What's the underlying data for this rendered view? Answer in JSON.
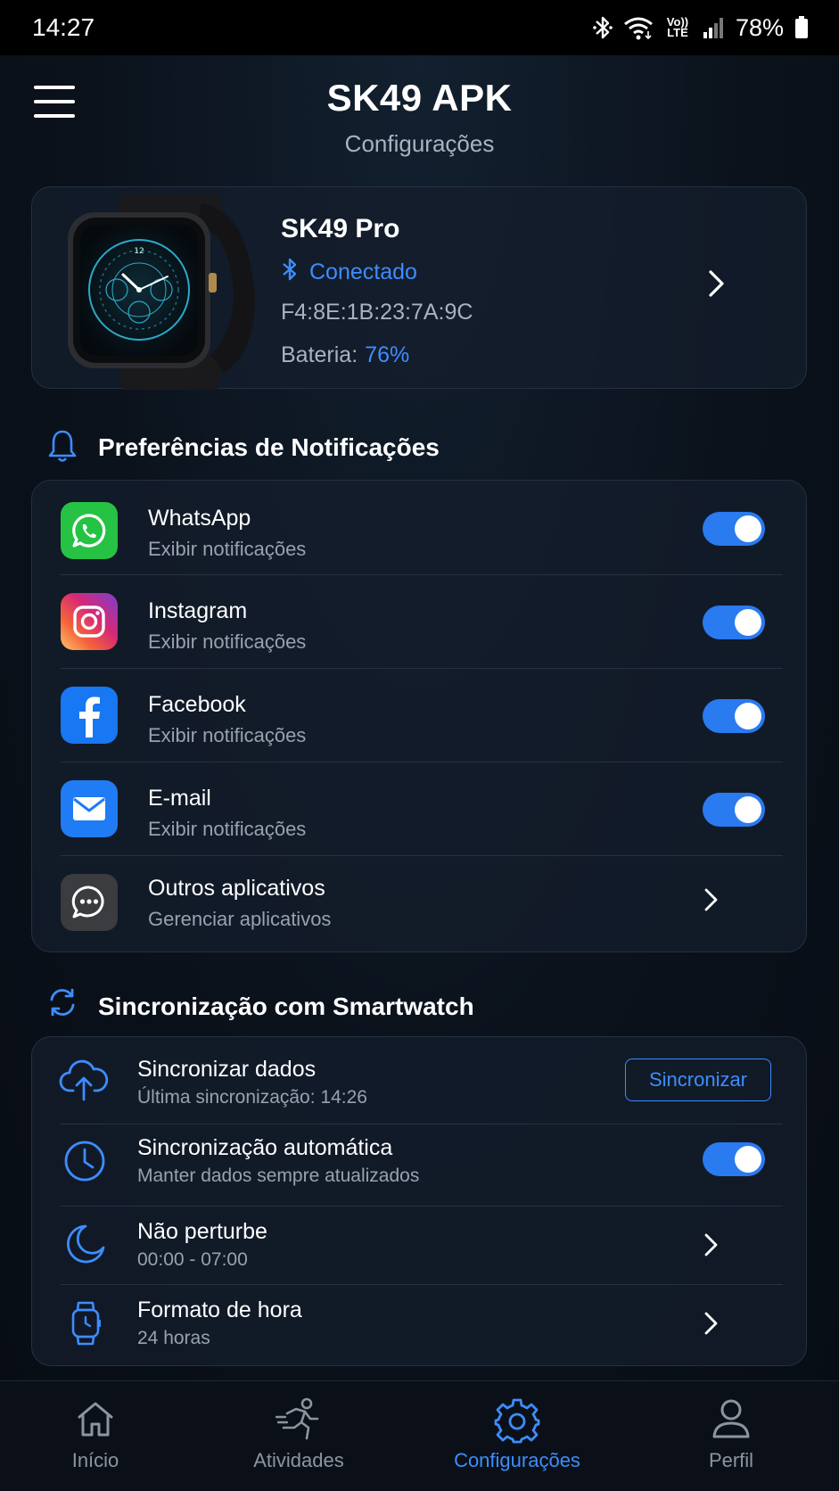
{
  "status_bar": {
    "time": "14:27",
    "volte": "Vo)) LTE",
    "battery": "78%"
  },
  "header": {
    "title": "SK49 APK",
    "subtitle": "Configurações"
  },
  "device": {
    "name": "SK49 Pro",
    "status": "Conectado",
    "mac": "F4:8E:1B:23:7A:9C",
    "battery_label": "Bateria:",
    "battery_value": "76%"
  },
  "notifications": {
    "title": "Preferências de Notificações",
    "items": [
      {
        "name": "WhatsApp",
        "sub": "Exibir notificações",
        "enabled": true
      },
      {
        "name": "Instagram",
        "sub": "Exibir notificações",
        "enabled": true
      },
      {
        "name": "Facebook",
        "sub": "Exibir notificações",
        "enabled": true
      },
      {
        "name": "E-mail",
        "sub": "Exibir notificações",
        "enabled": true
      },
      {
        "name": "Outros aplicativos",
        "sub": "Gerenciar aplicativos"
      }
    ]
  },
  "sync": {
    "title": "Sincronização com Smartwatch",
    "items": [
      {
        "name": "Sincronizar dados",
        "sub": "Última sincronização: 14:26",
        "button": "Sincronizar"
      },
      {
        "name": "Sincronização automática",
        "sub": "Manter dados sempre atualizados",
        "enabled": true
      },
      {
        "name": "Não perturbe",
        "sub": "00:00 - 07:00"
      },
      {
        "name": "Formato de hora",
        "sub": "24 horas"
      }
    ]
  },
  "nav": {
    "items": [
      {
        "label": "Início",
        "icon": "home-icon"
      },
      {
        "label": "Atividades",
        "icon": "running-icon"
      },
      {
        "label": "Configurações",
        "icon": "gear-icon",
        "active": true
      },
      {
        "label": "Perfil",
        "icon": "profile-icon"
      }
    ]
  },
  "colors": {
    "accent": "#3d8dff",
    "toggle_on": "#2a7af0",
    "background": "#0a1018"
  }
}
